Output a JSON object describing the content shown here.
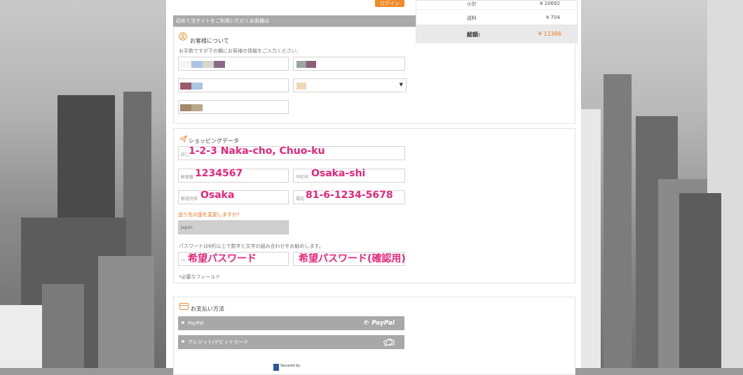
{
  "header": {
    "login_label": "ログイン"
  },
  "section_title": "初めて当サイトをご利用いただくお客様は",
  "customer": {
    "heading": "お客様について",
    "hint": "お手数ですが下の欄にお客様の情報をご入力ください:"
  },
  "shipping": {
    "heading": "ショッピングデータ",
    "address_label": "詳し",
    "address_value": "1-2-3 Naka-cho, Chuo-ku",
    "postal_label": "郵便番",
    "postal_value": "1234567",
    "city_label": "市町村",
    "city_value": "Osaka-shi",
    "prefecture_label": "都道府県",
    "prefecture_value": "Osaka",
    "phone_label": "電話",
    "phone_value": "81-6-1234-5678",
    "change_country_link": "送り先の国を変更しますか？",
    "country_value": "Japan",
    "password_hint": "パスワードは6桁以上で数字と文字の組み合わせをお勧めします。",
    "password_label": "パ",
    "password_value": "希望パスワード",
    "password_confirm_value": "希望パスワード(確認用)",
    "required_note": "*必要なフィールド"
  },
  "payment": {
    "heading": "お支払い方法",
    "paypal_label": "PayPal",
    "paypal_logo": "PayPal",
    "card_label": "クレジット/デビットカード",
    "secured_by": "Secured by"
  },
  "summary": {
    "subtotal_label": "小計",
    "subtotal_value": "¥ 10692",
    "shipping_label": "送料",
    "shipping_value": "¥ 704",
    "total_label": "総額:",
    "total_value": "¥ 11396"
  },
  "colors": {
    "accent": "#f08a2a",
    "highlight_text": "#e6267a",
    "section_bar": "#a9a9a9",
    "total_value": "#e8731d"
  }
}
